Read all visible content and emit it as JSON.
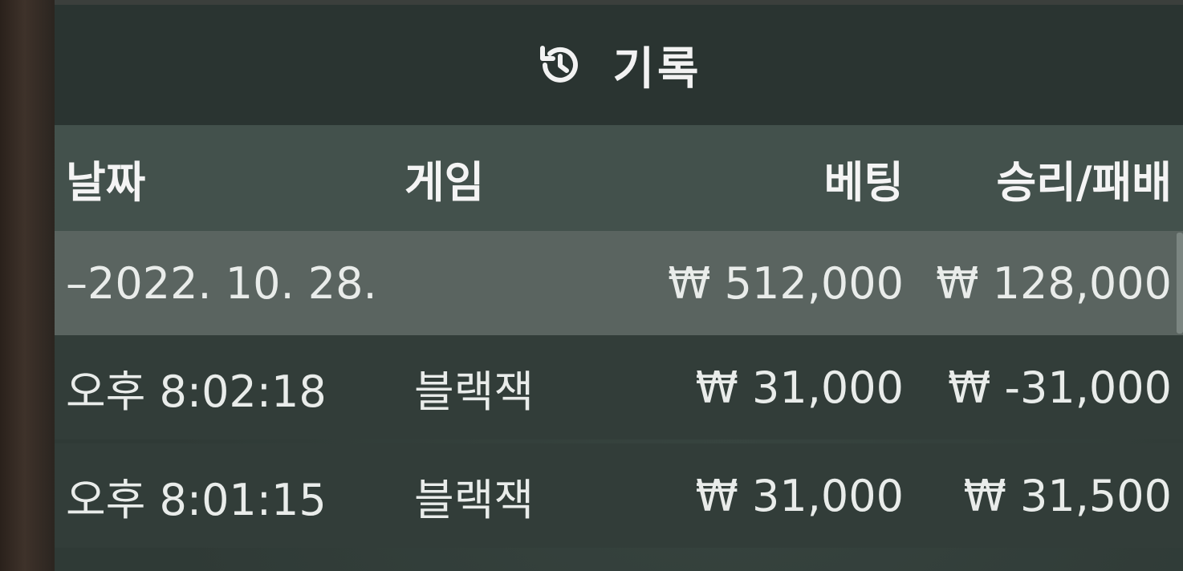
{
  "header": {
    "title": "기록",
    "icon": "history-icon"
  },
  "columns": {
    "date": "날짜",
    "game": "게임",
    "bet": "베팅",
    "result": "승리/패배"
  },
  "summary": {
    "date": "–2022. 10. 28.",
    "bet": "₩ 512,000",
    "result": "₩ 128,000"
  },
  "entries": [
    {
      "time": "오후 8:02:18",
      "game": "블랙잭",
      "bet": "₩ 31,000",
      "result": "₩ -31,000"
    },
    {
      "time": "오후 8:01:15",
      "game": "블랙잭",
      "bet": "₩ 31,000",
      "result": "₩ 31,500"
    }
  ],
  "colors": {
    "title_bar": "#2a3431",
    "header_row": "#43514c",
    "summary_row": "#5a6460",
    "panel": "#2f3a36",
    "text": "#e9ecea"
  }
}
